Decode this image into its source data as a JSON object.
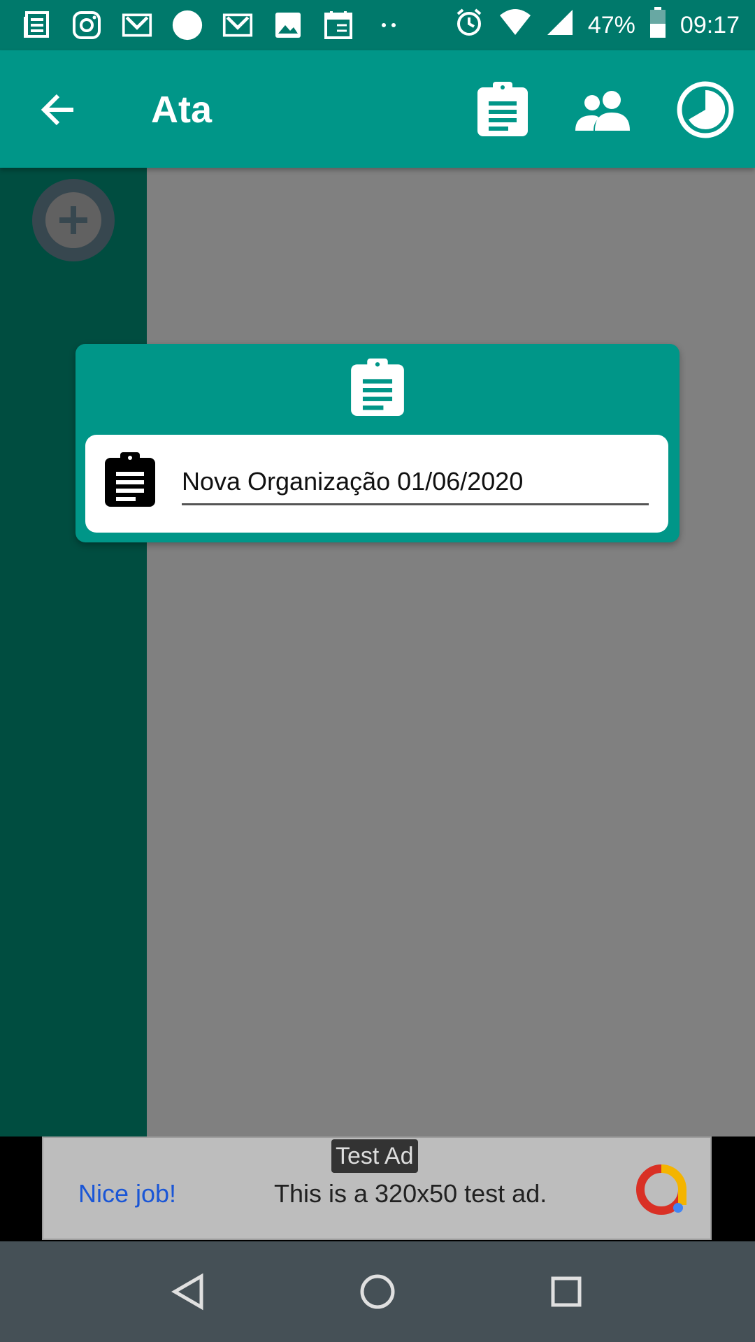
{
  "status_bar": {
    "notification_icons": [
      "news-icon",
      "instagram-icon",
      "gmail-icon",
      "circle-icon",
      "gmail-icon",
      "image-icon",
      "calendar-icon",
      "more-dots-icon"
    ],
    "battery": "47%",
    "time": "09:17"
  },
  "app_bar": {
    "title": "Ata",
    "actions": [
      "clipboard-icon",
      "people-icon",
      "history-icon"
    ]
  },
  "side_panel": {
    "add_button_icon": "plus-icon"
  },
  "dialog": {
    "header_icon": "clipboard-icon",
    "item_icon": "clipboard-icon",
    "name_value": "Nova Organização 01/06/2020"
  },
  "ad": {
    "badge": "Test Ad",
    "nice": "Nice job!",
    "text": "This is a 320x50 test ad."
  },
  "colors": {
    "status_bar": "#00796b",
    "app_bar": "#009688",
    "side_panel": "#004d40",
    "scrim": "#808080",
    "nav_bar": "#455056"
  },
  "nav_bar": [
    "back-triangle-icon",
    "home-circle-icon",
    "recents-square-icon"
  ]
}
